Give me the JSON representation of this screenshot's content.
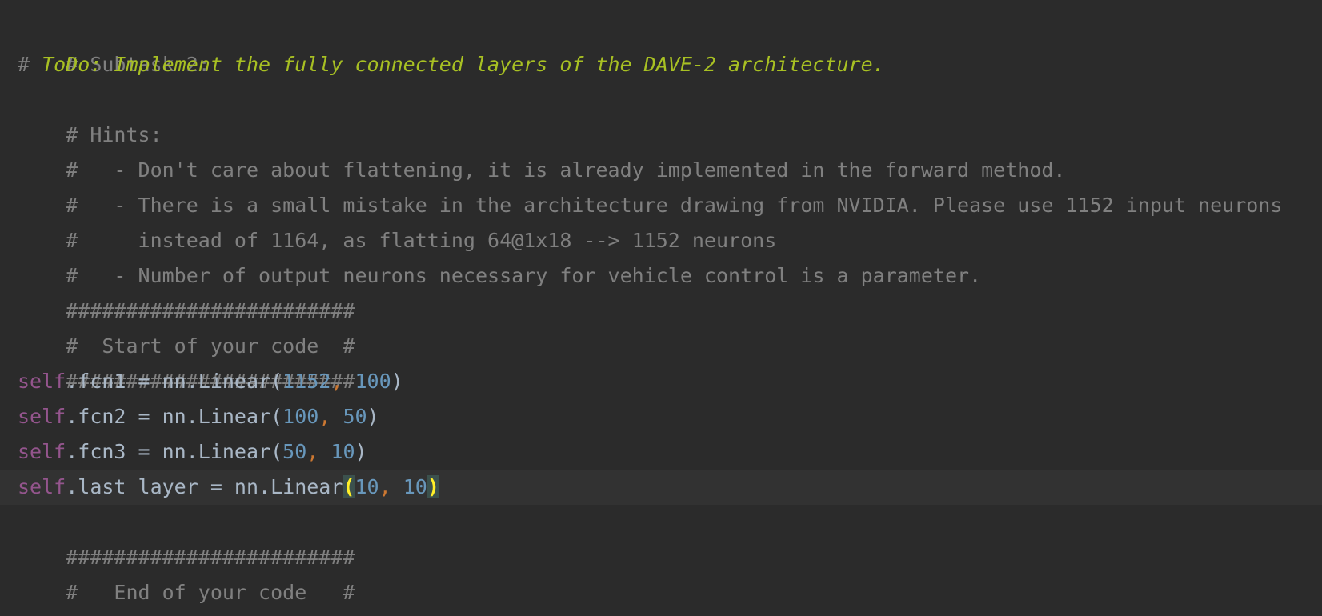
{
  "editor": {
    "colors": {
      "background": "#2b2b2b",
      "current_line": "#323232",
      "comment": "#808080",
      "todo": "#a8c023",
      "keyword_self": "#94558d",
      "text": "#a9b7c6",
      "number": "#6897bb",
      "comma": "#cc7832",
      "brace_match": "#ffef28"
    },
    "lines": [
      {
        "comment": "# Subtask 2:"
      },
      {
        "hash": "# ",
        "todo": "ToDo: Implement the fully connected layers of the DAVE-2 architecture."
      },
      {
        "comment": "# Hints:"
      },
      {
        "comment": "#   - Don't care about flattening, it is already implemented in the forward method."
      },
      {
        "comment": "#   - There is a small mistake in the architecture drawing from NVIDIA. Please use 1152 input neurons"
      },
      {
        "comment": "#     instead of 1164, as flatting 64@1x18 --> 1152 neurons"
      },
      {
        "comment": "#   - Number of output neurons necessary for vehicle control is a parameter."
      },
      {
        "comment": "########################"
      },
      {
        "comment": "#  Start of your code  #"
      },
      {
        "comment": "########################"
      },
      {
        "self": "self",
        "mid": ".fcn1 = nn.Linear(",
        "n1": "1152",
        "comma": ",",
        "space": " ",
        "n2": "100",
        "close": ")"
      },
      {
        "self": "self",
        "mid": ".fcn2 = nn.Linear(",
        "n1": "100",
        "comma": ",",
        "space": " ",
        "n2": "50",
        "close": ")"
      },
      {
        "self": "self",
        "mid": ".fcn3 = nn.Linear(",
        "n1": "50",
        "comma": ",",
        "space": " ",
        "n2": "10",
        "close": ")"
      },
      {
        "self": "self",
        "mid": ".last_layer = nn.Linear",
        "open": "(",
        "n1": "10",
        "comma": ",",
        "space": " ",
        "n2": "10",
        "close": ")"
      },
      {
        "comment": "########################"
      },
      {
        "comment": "#   End of your code   #"
      },
      {
        "comment": "########################"
      }
    ]
  }
}
